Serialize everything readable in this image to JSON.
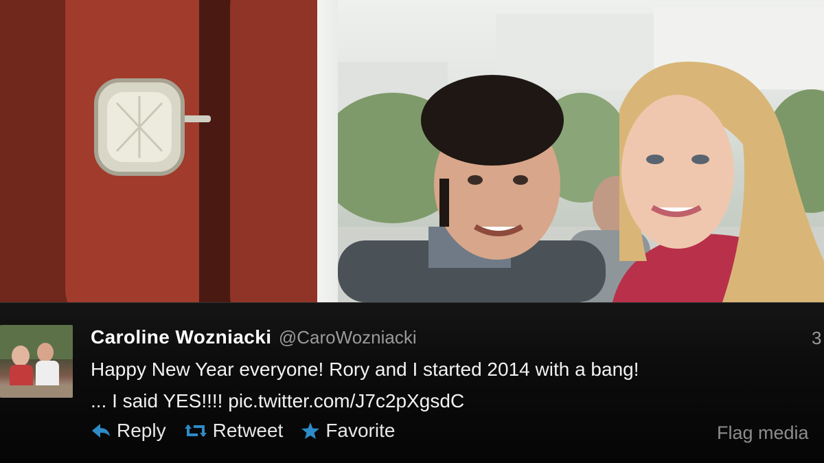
{
  "tweet": {
    "display_name": "Caroline Wozniacki",
    "handle": "@CaroWozniacki",
    "timestamp": "3",
    "text_line1": "Happy New Year everyone! Rory and I started 2014 with a bang!",
    "text_line2_prefix": "... I said YES!!!! ",
    "link": "pic.twitter.com/J7c2pXgsdC",
    "actions": {
      "reply": "Reply",
      "retweet": "Retweet",
      "favorite": "Favorite"
    },
    "flag": "Flag media"
  },
  "colors": {
    "action_icon": "#2d8bc9",
    "name": "#ffffff",
    "handle": "#9a9a9a"
  },
  "icons": [
    "reply-arrow-icon",
    "retweet-icon",
    "favorite-star-icon"
  ]
}
